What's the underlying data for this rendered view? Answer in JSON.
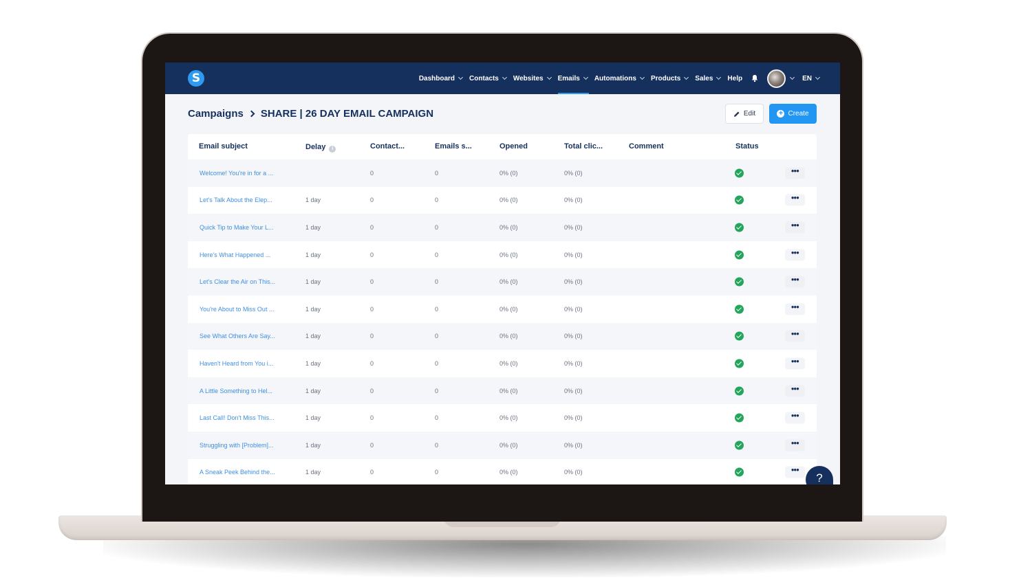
{
  "nav": {
    "items": [
      {
        "label": "Dashboard",
        "dropdown": true,
        "active": false
      },
      {
        "label": "Contacts",
        "dropdown": true,
        "active": false
      },
      {
        "label": "Websites",
        "dropdown": true,
        "active": false
      },
      {
        "label": "Emails",
        "dropdown": true,
        "active": true
      },
      {
        "label": "Automations",
        "dropdown": true,
        "active": false
      },
      {
        "label": "Products",
        "dropdown": true,
        "active": false
      },
      {
        "label": "Sales",
        "dropdown": true,
        "active": false
      },
      {
        "label": "Help",
        "dropdown": false,
        "active": false
      }
    ],
    "language": "EN",
    "logo_letter": "S"
  },
  "header": {
    "breadcrumb_root": "Campaigns",
    "breadcrumb_current": "SHARE | 26 DAY EMAIL CAMPAIGN",
    "edit_label": "Edit",
    "create_label": "Create"
  },
  "table": {
    "columns": {
      "subject": "Email subject",
      "delay": "Delay",
      "contacts": "Contact...",
      "emails_sent": "Emails s...",
      "opened": "Opened",
      "total_clicks": "Total clic...",
      "comment": "Comment",
      "status": "Status"
    },
    "rows": [
      {
        "subject": "Welcome! You're in for a ...",
        "delay": "",
        "contacts": "0",
        "emails_sent": "0",
        "opened": "0% (0)",
        "clicks": "0% (0)"
      },
      {
        "subject": "Let's Talk About the Elep...",
        "delay": "1 day",
        "contacts": "0",
        "emails_sent": "0",
        "opened": "0% (0)",
        "clicks": "0% (0)"
      },
      {
        "subject": "Quick Tip to Make Your L...",
        "delay": "1 day",
        "contacts": "0",
        "emails_sent": "0",
        "opened": "0% (0)",
        "clicks": "0% (0)"
      },
      {
        "subject": "Here's What Happened ...",
        "delay": "1 day",
        "contacts": "0",
        "emails_sent": "0",
        "opened": "0% (0)",
        "clicks": "0% (0)"
      },
      {
        "subject": "Let's Clear the Air on This...",
        "delay": "1 day",
        "contacts": "0",
        "emails_sent": "0",
        "opened": "0% (0)",
        "clicks": "0% (0)"
      },
      {
        "subject": "You're About to Miss Out ...",
        "delay": "1 day",
        "contacts": "0",
        "emails_sent": "0",
        "opened": "0% (0)",
        "clicks": "0% (0)"
      },
      {
        "subject": "See What Others Are Say...",
        "delay": "1 day",
        "contacts": "0",
        "emails_sent": "0",
        "opened": "0% (0)",
        "clicks": "0% (0)"
      },
      {
        "subject": "Haven't Heard from You i...",
        "delay": "1 day",
        "contacts": "0",
        "emails_sent": "0",
        "opened": "0% (0)",
        "clicks": "0% (0)"
      },
      {
        "subject": "A Little Something to Hel...",
        "delay": "1 day",
        "contacts": "0",
        "emails_sent": "0",
        "opened": "0% (0)",
        "clicks": "0% (0)"
      },
      {
        "subject": "Last Call! Don't Miss This...",
        "delay": "1 day",
        "contacts": "0",
        "emails_sent": "0",
        "opened": "0% (0)",
        "clicks": "0% (0)"
      },
      {
        "subject": "Struggling with [Problem]...",
        "delay": "1 day",
        "contacts": "0",
        "emails_sent": "0",
        "opened": "0% (0)",
        "clicks": "0% (0)"
      },
      {
        "subject": "A Sneak Peek Behind the...",
        "delay": "1 day",
        "contacts": "0",
        "emails_sent": "0",
        "opened": "0% (0)",
        "clicks": "0% (0)"
      }
    ],
    "more_label": "•••"
  },
  "help_widget": "?",
  "colors": {
    "nav_bg": "#16305e",
    "accent": "#2196f3",
    "link": "#3f8fe0",
    "status_ok": "#23a55c"
  }
}
